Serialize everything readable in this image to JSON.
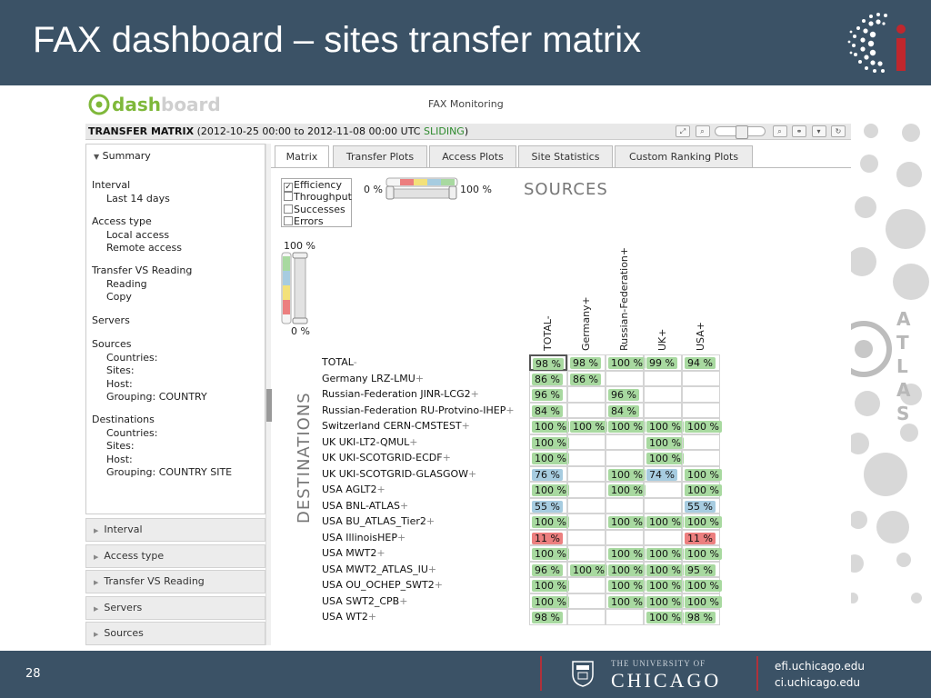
{
  "slide": {
    "title": "FAX dashboard – sites transfer matrix",
    "number": "28",
    "university_top": "THE UNIVERSITY OF",
    "university_main": "CHICAGO",
    "link_1": "efi.uchicago.edu",
    "link_2": "ci.uchicago.edu",
    "atlas_letters": "ATLAS"
  },
  "app": {
    "logo_text": "dashboard",
    "monitoring_title": "FAX Monitoring",
    "matrix_bar": {
      "title": "TRANSFER MATRIX",
      "range": "(2012-10-25 00:00 to 2012-11-08 00:00 UTC",
      "mode": "SLIDING",
      "close": ")"
    }
  },
  "left_panel": {
    "summary_label": "Summary",
    "interval_title": "Interval",
    "interval_value": "Last 14 days",
    "access_title": "Access type",
    "access_local": "Local access",
    "access_remote": "Remote access",
    "tvr_title": "Transfer VS Reading",
    "tvr_reading": "Reading",
    "tvr_copy": "Copy",
    "servers_title": "Servers",
    "sources_title": "Sources",
    "sources_countries": "Countries:",
    "sources_sites": "Sites:",
    "sources_host": "Host:",
    "sources_grouping_label": "Grouping:",
    "sources_grouping_value": "COUNTRY",
    "dest_title": "Destinations",
    "dest_countries": "Countries:",
    "dest_sites": "Sites:",
    "dest_host": "Host:",
    "dest_grouping_label": "Grouping:",
    "dest_grouping_value": "COUNTRY SITE"
  },
  "accordion": [
    "Interval",
    "Access type",
    "Transfer VS Reading",
    "Servers",
    "Sources"
  ],
  "tabs": [
    "Matrix",
    "Transfer Plots",
    "Access Plots",
    "Site Statistics",
    "Custom Ranking Plots"
  ],
  "controls": {
    "metrics": [
      "Efficiency",
      "Throughput",
      "Successes",
      "Errors"
    ],
    "metric_checked": "Efficiency",
    "range_min": "0 %",
    "range_max": "100 %",
    "scale_top": "100 %",
    "scale_bottom": "0 %",
    "sources_label": "SOURCES",
    "destinations_label": "DESTINATIONS"
  },
  "colors": {
    "green": "#a8d9a0",
    "blue": "#a7cce0",
    "red": "#ec7f7f",
    "header": "#3b5266",
    "accent_red": "#b0313a"
  },
  "matrix": {
    "columns": [
      "TOTAL-",
      "Germany+",
      "Russian-Federation+",
      "UK+",
      "USA+"
    ],
    "rows": [
      {
        "label": "TOTAL",
        "suffix": "-",
        "cells": [
          "98 %",
          "98 %",
          "100 %",
          "99 %",
          "94 %"
        ],
        "colors": [
          "green",
          "green",
          "green",
          "green",
          "green"
        ]
      },
      {
        "label": "Germany LRZ-LMU",
        "suffix": "+",
        "cells": [
          "86 %",
          "86 %",
          "",
          "",
          ""
        ],
        "colors": [
          "green",
          "green",
          "",
          "",
          ""
        ]
      },
      {
        "label": "Russian-Federation JINR-LCG2",
        "suffix": "+",
        "cells": [
          "96 %",
          "",
          "96 %",
          "",
          ""
        ],
        "colors": [
          "green",
          "",
          "green",
          "",
          ""
        ]
      },
      {
        "label": "Russian-Federation RU-Protvino-IHEP",
        "suffix": "+",
        "cells": [
          "84 %",
          "",
          "84 %",
          "",
          ""
        ],
        "colors": [
          "green",
          "",
          "green",
          "",
          ""
        ]
      },
      {
        "label": "Switzerland CERN-CMSTEST",
        "suffix": "+",
        "cells": [
          "100 %",
          "100 %",
          "100 %",
          "100 %",
          "100 %"
        ],
        "colors": [
          "green",
          "green",
          "green",
          "green",
          "green"
        ]
      },
      {
        "label": "UK UKI-LT2-QMUL",
        "suffix": "+",
        "cells": [
          "100 %",
          "",
          "",
          "100 %",
          ""
        ],
        "colors": [
          "green",
          "",
          "",
          "green",
          ""
        ]
      },
      {
        "label": "UK UKI-SCOTGRID-ECDF",
        "suffix": "+",
        "cells": [
          "100 %",
          "",
          "",
          "100 %",
          ""
        ],
        "colors": [
          "green",
          "",
          "",
          "green",
          ""
        ]
      },
      {
        "label": "UK UKI-SCOTGRID-GLASGOW",
        "suffix": "+",
        "cells": [
          "76 %",
          "",
          "100 %",
          "74 %",
          "100 %"
        ],
        "colors": [
          "blue",
          "",
          "green",
          "blue",
          "green"
        ]
      },
      {
        "label": "USA AGLT2",
        "suffix": "+",
        "cells": [
          "100 %",
          "",
          "100 %",
          "",
          "100 %"
        ],
        "colors": [
          "green",
          "",
          "green",
          "",
          "green"
        ]
      },
      {
        "label": "USA BNL-ATLAS",
        "suffix": "+",
        "cells": [
          "55 %",
          "",
          "",
          "",
          "55 %"
        ],
        "colors": [
          "blue",
          "",
          "",
          "",
          "blue"
        ]
      },
      {
        "label": "USA BU_ATLAS_Tier2",
        "suffix": "+",
        "cells": [
          "100 %",
          "",
          "100 %",
          "100 %",
          "100 %"
        ],
        "colors": [
          "green",
          "",
          "green",
          "green",
          "green"
        ]
      },
      {
        "label": "USA IllinoisHEP",
        "suffix": "+",
        "cells": [
          "11 %",
          "",
          "",
          "",
          "11 %"
        ],
        "colors": [
          "red",
          "",
          "",
          "",
          "red"
        ]
      },
      {
        "label": "USA MWT2",
        "suffix": "+",
        "cells": [
          "100 %",
          "",
          "100 %",
          "100 %",
          "100 %"
        ],
        "colors": [
          "green",
          "",
          "green",
          "green",
          "green"
        ]
      },
      {
        "label": "USA MWT2_ATLAS_IU",
        "suffix": "+",
        "cells": [
          "96 %",
          "100 %",
          "100 %",
          "100 %",
          "95 %"
        ],
        "colors": [
          "green",
          "green",
          "green",
          "green",
          "green"
        ]
      },
      {
        "label": "USA OU_OCHEP_SWT2",
        "suffix": "+",
        "cells": [
          "100 %",
          "",
          "100 %",
          "100 %",
          "100 %"
        ],
        "colors": [
          "green",
          "",
          "green",
          "green",
          "green"
        ]
      },
      {
        "label": "USA SWT2_CPB",
        "suffix": "+",
        "cells": [
          "100 %",
          "",
          "100 %",
          "100 %",
          "100 %"
        ],
        "colors": [
          "green",
          "",
          "green",
          "green",
          "green"
        ]
      },
      {
        "label": "USA WT2",
        "suffix": "+",
        "cells": [
          "98 %",
          "",
          "",
          "100 %",
          "98 %"
        ],
        "colors": [
          "green",
          "",
          "",
          "green",
          "green"
        ]
      }
    ]
  }
}
